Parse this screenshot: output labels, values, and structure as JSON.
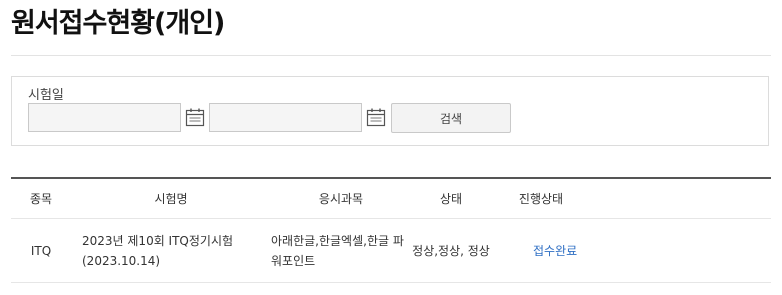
{
  "page": {
    "title": "원서접수현황(개인)"
  },
  "search": {
    "label": "시험일",
    "start_date": {
      "value": "",
      "placeholder": ""
    },
    "end_date": {
      "value": "",
      "placeholder": ""
    },
    "button_label": "검색"
  },
  "table": {
    "headers": [
      "종목",
      "시험명",
      "응시과목",
      "상태",
      "진행상태"
    ],
    "rows": [
      {
        "item": "ITQ",
        "exam_name": "2023년 제10회 ITQ정기시험 (2023.10.14)",
        "subjects": "아래한글,한글엑셀,한글 파워포인트",
        "state": "정상,정상, 정상",
        "progress": "접수완료"
      }
    ]
  },
  "icons": {
    "calendar": "calendar-icon"
  },
  "colors": {
    "link": "#2f6fc4",
    "table_header_border": "#555555"
  }
}
